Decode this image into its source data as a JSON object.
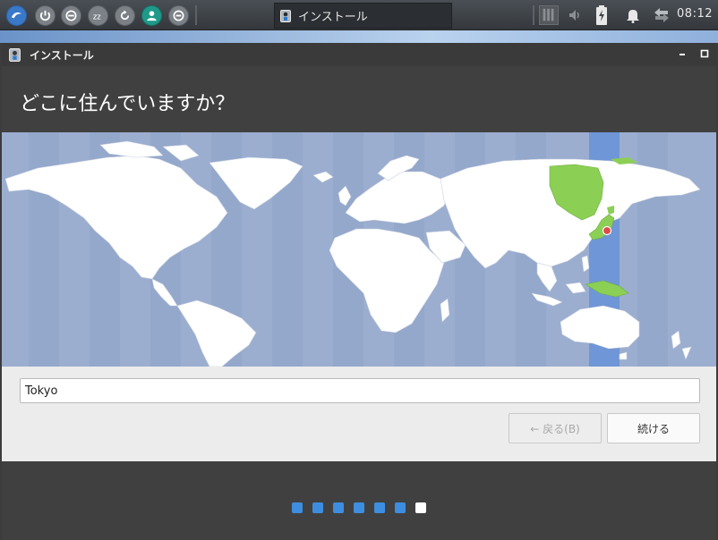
{
  "taskbar": {
    "launcher_buttons": [
      "logo-icon",
      "power-icon",
      "logout-icon",
      "sleep-icon",
      "restart-icon",
      "user-icon",
      "lock-icon"
    ],
    "task_title": "インストール",
    "tray_icons": [
      "workspace-icon",
      "volume-icon",
      "battery-icon",
      "notification-icon",
      "network-icon"
    ],
    "clock": "08:12"
  },
  "window": {
    "title": "インストール",
    "controls": [
      "minimize",
      "maximize"
    ]
  },
  "page": {
    "heading": "どこに住んでいますか？"
  },
  "timezone_map": {
    "selected_zone_color": "#6f96d6",
    "highlight_color": "#8ccf55",
    "marker_color": "#e04848",
    "ocean_color": "#9baed0",
    "land_color": "#ffffff"
  },
  "form": {
    "timezone_value": "Tokyo"
  },
  "buttons": {
    "back_label": "← 戻る(B)",
    "next_label": "続ける"
  },
  "progress": {
    "total_steps": 7,
    "current_step": 7
  }
}
